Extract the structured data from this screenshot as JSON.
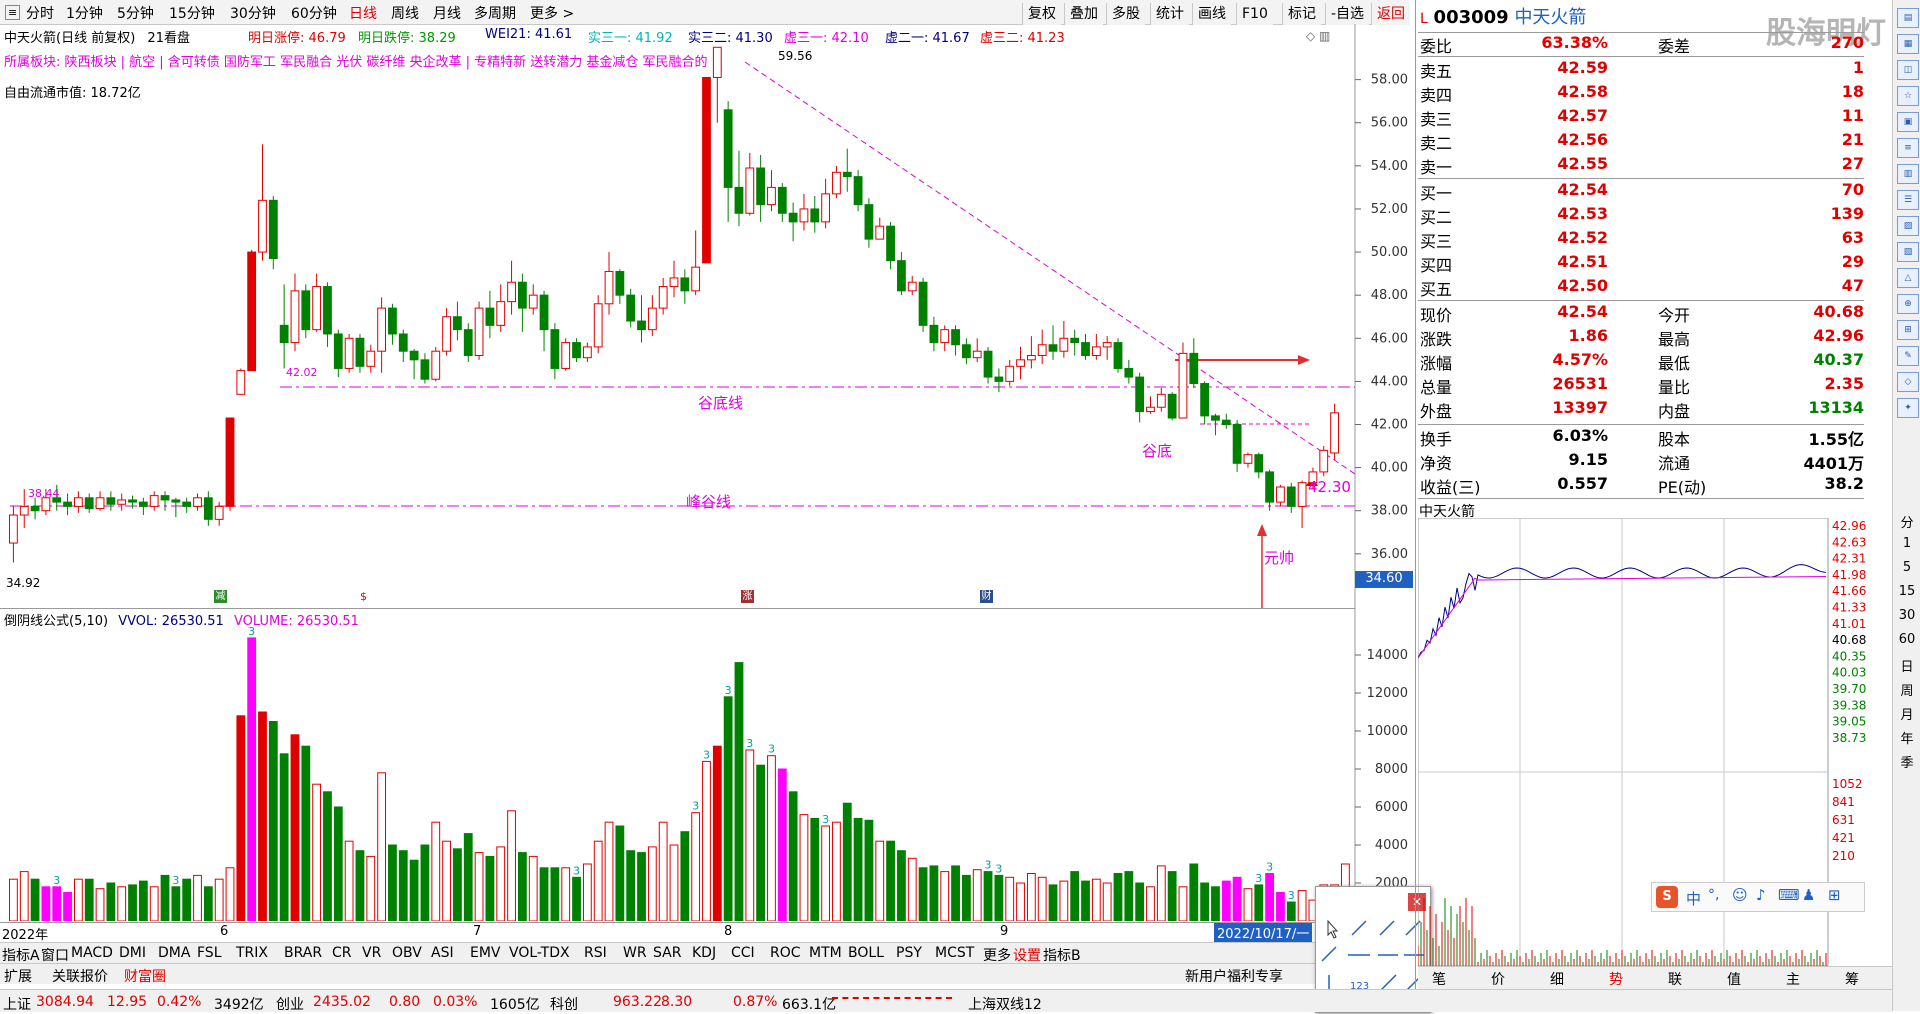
{
  "toolbar": {
    "periods": [
      "分时",
      "1分钟",
      "5分钟",
      "15分钟",
      "30分钟",
      "60分钟",
      "日线",
      "周线",
      "月线",
      "多周期",
      "更多 >"
    ],
    "right_buttons": [
      "复权",
      "叠加",
      "多股",
      "统计",
      "画线",
      "F10",
      "标记",
      "-自选",
      "返回"
    ]
  },
  "stock_header": {
    "prefix": "L",
    "code": "003009",
    "name": "中天火箭",
    "watermark": "股海明灯"
  },
  "chart_header": {
    "title": "中天火箭(日线 前复权)",
    "views": "21看盘",
    "limit_up_label": "明日涨停:",
    "limit_up": "46.79",
    "limit_down_label": "明日跌停:",
    "limit_down": "38.29",
    "wei21": "WEI21: 41.61",
    "shi1": "实三一: 41.92",
    "shi2": "实三二: 41.30",
    "xu31": "虚三一: 42.10",
    "xu21": "虚二一: 41.67",
    "xu32": "虚三二: 41.23",
    "sectors": "所属板块: 陕西板块 | 航空 | 含可转债 国防军工 军民融合 光伏 碳纤维 央企改革 | 专精特新 送转潜力 基金减仓 军民融合的",
    "float_cap": "自由流通市值: 18.72亿"
  },
  "annotations": {
    "valley_line": "谷底线",
    "peak_valley_line": "峰谷线",
    "valley": "谷底",
    "yuanshuai": "元帅",
    "price_4230": "42.30",
    "high_label": "59.56",
    "low_label": "34.92",
    "left_label": "38.44",
    "mid_label": "42.02",
    "cursor_price": "34.60"
  },
  "chart_data": {
    "type": "candlestick",
    "price_axis": [
      "58.00",
      "56.00",
      "54.00",
      "52.00",
      "50.00",
      "48.00",
      "46.00",
      "44.00",
      "42.00",
      "40.00",
      "38.00",
      "36.00"
    ],
    "ylim": [
      34.6,
      59.56
    ],
    "candles": [
      [
        36.5,
        37.8,
        35.6,
        38.2
      ],
      [
        37.8,
        38.2,
        37.2,
        39.0
      ],
      [
        38.2,
        38.0,
        37.6,
        38.6
      ],
      [
        38.0,
        38.6,
        37.8,
        39.0
      ],
      [
        38.6,
        38.4,
        38.0,
        39.2
      ],
      [
        38.4,
        38.2,
        37.8,
        38.8
      ],
      [
        38.2,
        38.6,
        37.9,
        38.9
      ],
      [
        38.6,
        38.1,
        37.9,
        38.8
      ],
      [
        38.1,
        38.6,
        38.0,
        38.9
      ],
      [
        38.6,
        38.3,
        38.0,
        38.9
      ],
      [
        38.3,
        38.5,
        38.0,
        38.8
      ],
      [
        38.5,
        38.4,
        38.1,
        38.7
      ],
      [
        38.4,
        38.2,
        37.8,
        38.6
      ],
      [
        38.2,
        38.7,
        38.0,
        38.9
      ],
      [
        38.7,
        38.5,
        38.0,
        38.9
      ],
      [
        38.5,
        38.4,
        37.7,
        38.6
      ],
      [
        38.4,
        38.2,
        37.9,
        38.6
      ],
      [
        38.2,
        38.6,
        38.0,
        38.8
      ],
      [
        38.6,
        37.6,
        37.3,
        38.9
      ],
      [
        37.6,
        38.2,
        37.3,
        38.4
      ],
      [
        38.2,
        42.3,
        38.0,
        42.3
      ],
      [
        43.4,
        44.5,
        43.8,
        44.6
      ],
      [
        44.5,
        50.0,
        45.0,
        50.1
      ],
      [
        50.0,
        52.4,
        49.6,
        55.0
      ],
      [
        52.4,
        49.7,
        49.2,
        52.6
      ],
      [
        46.6,
        45.8,
        44.6,
        48.5
      ],
      [
        45.8,
        48.2,
        45.4,
        49.0
      ],
      [
        48.2,
        46.4,
        46.0,
        48.5
      ],
      [
        46.4,
        48.4,
        46.3,
        49.0
      ],
      [
        48.4,
        46.2,
        45.6,
        48.6
      ],
      [
        46.2,
        44.6,
        44.2,
        46.4
      ],
      [
        44.6,
        46.0,
        44.4,
        46.2
      ],
      [
        46.0,
        44.7,
        44.4,
        46.2
      ],
      [
        44.7,
        45.4,
        44.4,
        45.7
      ],
      [
        45.4,
        47.4,
        44.4,
        47.9
      ],
      [
        47.4,
        46.2,
        45.7,
        47.6
      ],
      [
        46.2,
        45.4,
        44.9,
        46.4
      ],
      [
        45.4,
        45.0,
        44.1,
        45.5
      ],
      [
        45.0,
        44.1,
        43.9,
        45.3
      ],
      [
        44.1,
        45.4,
        44.0,
        45.6
      ],
      [
        45.4,
        47.0,
        45.2,
        47.4
      ],
      [
        47.0,
        46.4,
        45.9,
        47.7
      ],
      [
        46.4,
        45.2,
        44.9,
        46.7
      ],
      [
        45.2,
        47.4,
        45.0,
        47.7
      ],
      [
        47.4,
        46.6,
        46.0,
        48.2
      ],
      [
        46.6,
        47.7,
        46.3,
        48.5
      ],
      [
        47.7,
        48.6,
        47.1,
        49.6
      ],
      [
        48.6,
        47.4,
        46.3,
        49.0
      ],
      [
        47.4,
        48.0,
        47.1,
        48.5
      ],
      [
        48.0,
        46.4,
        45.4,
        48.2
      ],
      [
        46.4,
        44.6,
        44.1,
        46.7
      ],
      [
        44.6,
        45.8,
        44.5,
        46.0
      ],
      [
        45.8,
        45.1,
        44.9,
        46.0
      ],
      [
        45.1,
        45.6,
        44.9,
        45.8
      ],
      [
        45.6,
        47.6,
        45.3,
        48.0
      ],
      [
        47.6,
        49.1,
        47.1,
        50.0
      ],
      [
        49.1,
        48.0,
        47.6,
        49.2
      ],
      [
        48.0,
        46.8,
        46.5,
        48.3
      ],
      [
        46.8,
        46.4,
        45.8,
        48.0
      ],
      [
        46.4,
        47.4,
        46.1,
        48.0
      ],
      [
        47.4,
        48.4,
        47.1,
        48.8
      ],
      [
        48.4,
        48.8,
        47.9,
        49.6
      ],
      [
        48.8,
        48.2,
        47.6,
        49.2
      ],
      [
        48.2,
        49.3,
        48.0,
        51.0
      ],
      [
        49.5,
        58.1,
        49.6,
        58.1
      ],
      [
        58.1,
        59.5,
        56.0,
        59.5
      ],
      [
        56.6,
        53.0,
        51.4,
        57.0
      ],
      [
        53.0,
        51.8,
        51.2,
        54.7
      ],
      [
        51.8,
        53.9,
        51.7,
        54.6
      ],
      [
        53.9,
        52.2,
        51.4,
        54.5
      ],
      [
        52.2,
        53.0,
        51.9,
        53.8
      ],
      [
        53.0,
        51.8,
        51.4,
        53.2
      ],
      [
        51.8,
        51.4,
        50.5,
        52.3
      ],
      [
        51.4,
        52.0,
        51.0,
        52.7
      ],
      [
        52.0,
        51.4,
        50.9,
        52.6
      ],
      [
        51.4,
        52.7,
        51.1,
        53.4
      ],
      [
        52.7,
        53.7,
        52.5,
        54.0
      ],
      [
        53.7,
        53.5,
        52.8,
        54.8
      ],
      [
        53.5,
        52.2,
        51.9,
        53.8
      ],
      [
        52.2,
        50.6,
        50.2,
        52.5
      ],
      [
        50.6,
        51.2,
        50.6,
        51.6
      ],
      [
        51.2,
        49.6,
        49.2,
        51.4
      ],
      [
        49.6,
        48.2,
        48.0,
        50.0
      ],
      [
        48.2,
        48.6,
        48.0,
        48.9
      ],
      [
        48.6,
        46.6,
        46.3,
        48.8
      ],
      [
        46.6,
        45.8,
        45.4,
        47.0
      ],
      [
        45.8,
        46.4,
        45.4,
        46.6
      ],
      [
        46.4,
        45.7,
        45.2,
        46.6
      ],
      [
        45.7,
        45.1,
        44.8,
        46.0
      ],
      [
        45.1,
        45.4,
        44.9,
        46.0
      ],
      [
        45.4,
        44.2,
        43.9,
        45.6
      ],
      [
        44.2,
        44.0,
        43.5,
        44.6
      ],
      [
        44.0,
        44.7,
        43.8,
        45.0
      ],
      [
        44.7,
        45.0,
        44.1,
        45.6
      ],
      [
        45.0,
        45.2,
        44.6,
        46.1
      ],
      [
        45.2,
        45.7,
        44.8,
        46.4
      ],
      [
        45.7,
        45.4,
        45.0,
        46.6
      ],
      [
        45.4,
        46.0,
        45.1,
        46.8
      ],
      [
        46.0,
        45.8,
        45.2,
        46.4
      ],
      [
        45.8,
        45.2,
        45.0,
        46.2
      ],
      [
        45.2,
        45.6,
        45.0,
        46.2
      ],
      [
        45.6,
        45.8,
        45.0,
        46.1
      ],
      [
        45.8,
        44.6,
        44.4,
        46.0
      ],
      [
        44.6,
        44.2,
        43.9,
        45.0
      ],
      [
        44.2,
        42.6,
        42.1,
        44.4
      ],
      [
        42.6,
        42.8,
        42.5,
        43.3
      ],
      [
        42.8,
        43.4,
        42.6,
        43.7
      ],
      [
        43.4,
        42.3,
        42.2,
        43.5
      ],
      [
        42.3,
        45.3,
        42.6,
        45.8
      ],
      [
        45.3,
        43.9,
        43.7,
        46.0
      ],
      [
        43.9,
        42.4,
        42.0,
        44.0
      ],
      [
        42.4,
        42.2,
        41.5,
        42.5
      ],
      [
        42.2,
        42.0,
        41.8,
        42.5
      ],
      [
        42.0,
        40.2,
        39.8,
        42.2
      ],
      [
        40.2,
        40.6,
        40.0,
        40.7
      ],
      [
        40.6,
        39.8,
        39.5,
        40.7
      ],
      [
        39.8,
        38.4,
        38.0,
        39.9
      ],
      [
        38.4,
        39.1,
        38.2,
        39.2
      ],
      [
        39.1,
        38.2,
        37.9,
        39.3
      ],
      [
        38.2,
        39.3,
        37.2,
        39.4
      ],
      [
        39.3,
        39.8,
        39.0,
        40.0
      ],
      [
        39.8,
        40.8,
        39.6,
        41.0
      ],
      [
        40.68,
        42.54,
        40.37,
        42.96
      ]
    ],
    "volumes": [
      2200,
      2600,
      2200,
      1800,
      1800,
      1500,
      2200,
      2200,
      1700,
      2000,
      1800,
      1900,
      2100,
      1800,
      2400,
      1800,
      2200,
      2400,
      1800,
      2200,
      2800,
      10800,
      14900,
      11000,
      10500,
      8800,
      9800,
      9200,
      7200,
      6800,
      6000,
      4200,
      3700,
      3400,
      7800,
      4000,
      3700,
      3200,
      4000,
      5200,
      4200,
      3800,
      4600,
      3600,
      3400,
      3900,
      5800,
      3600,
      3400,
      2800,
      2800,
      2800,
      2300,
      3000,
      4200,
      5200,
      5000,
      3700,
      3600,
      3900,
      5200,
      4000,
      4700,
      5700,
      8400,
      9200,
      11800,
      13600,
      9000,
      8200,
      8700,
      8000,
      6800,
      5600,
      5400,
      5000,
      5200,
      6200,
      5400,
      5300,
      4200,
      4200,
      3700,
      3300,
      2800,
      2900,
      2600,
      2900,
      2400,
      2700,
      2600,
      2400,
      2300,
      2000,
      2500,
      2300,
      1900,
      2100,
      2600,
      2100,
      2200,
      2000,
      2500,
      2600,
      2000,
      1800,
      2900,
      2600,
      1800,
      3000,
      2000,
      1800,
      2100,
      2300,
      1700,
      1900,
      2500,
      1500,
      1000,
      1600,
      1100,
      1900,
      1900,
      3000
    ],
    "vol_axis": [
      "14000",
      "12000",
      "10000",
      "8000",
      "6000",
      "4000",
      "2000"
    ],
    "date_labels": [
      "2022年",
      "6",
      "7",
      "8",
      "9",
      "2022/10/17/一"
    ]
  },
  "volume_header": {
    "title": "倒阴线公式(5,10)",
    "vvol": "VVOL: 26530.51",
    "volume": "VOLUME: 26530.51"
  },
  "indicator_tabs": [
    "指标A",
    "窗口",
    "MACD",
    "DMI",
    "DMA",
    "FSL",
    "TRIX",
    "BRAR",
    "CR",
    "VR",
    "OBV",
    "ASI",
    "EMV",
    "VOL-TDX",
    "RSI",
    "WR",
    "SAR",
    "KDJ",
    "CCI",
    "ROC",
    "MTM",
    "BOLL",
    "PSY",
    "MCST",
    "更多",
    "设置",
    "指标B"
  ],
  "sub_tabs": [
    "扩展",
    "关联报价",
    "财富圈"
  ],
  "promo": "新用户福利专享",
  "order_book": {
    "weibi_label": "委比",
    "weibi": "63.38%",
    "weicha_label": "委差",
    "weicha": "270",
    "sells": [
      {
        "label": "卖五",
        "price": "42.59",
        "vol": "1"
      },
      {
        "label": "卖四",
        "price": "42.58",
        "vol": "18"
      },
      {
        "label": "卖三",
        "price": "42.57",
        "vol": "11"
      },
      {
        "label": "卖二",
        "price": "42.56",
        "vol": "21"
      },
      {
        "label": "卖一",
        "price": "42.55",
        "vol": "27"
      }
    ],
    "buys": [
      {
        "label": "买一",
        "price": "42.54",
        "vol": "70"
      },
      {
        "label": "买二",
        "price": "42.53",
        "vol": "139"
      },
      {
        "label": "买三",
        "price": "42.52",
        "vol": "63"
      },
      {
        "label": "买四",
        "price": "42.51",
        "vol": "29"
      },
      {
        "label": "买五",
        "price": "42.50",
        "vol": "47"
      }
    ]
  },
  "quote": [
    {
      "l1": "现价",
      "v1": "42.54",
      "l2": "今开",
      "v2": "40.68"
    },
    {
      "l1": "涨跌",
      "v1": "1.86",
      "l2": "最高",
      "v2": "42.96"
    },
    {
      "l1": "涨幅",
      "v1": "4.57%",
      "l2": "最低",
      "v2": "40.37"
    },
    {
      "l1": "总量",
      "v1": "26531",
      "l2": "量比",
      "v2": "2.35"
    },
    {
      "l1": "外盘",
      "v1": "13397",
      "l2": "内盘",
      "v2": "13134"
    }
  ],
  "fundamentals": [
    {
      "l1": "换手",
      "v1": "6.03%",
      "l2": "股本",
      "v2": "1.55亿"
    },
    {
      "l1": "净资",
      "v1": "9.15",
      "l2": "流通",
      "v2": "4401万"
    },
    {
      "l1": "收益(三)",
      "v1": "0.557",
      "l2": "PE(动)",
      "v2": "38.2"
    }
  ],
  "intraday": {
    "title": "中天火箭",
    "price_ticks": [
      "42.96",
      "42.63",
      "42.31",
      "41.98",
      "41.66",
      "41.33",
      "41.01",
      "40.68",
      "40.35",
      "40.03",
      "39.70",
      "39.38",
      "39.05",
      "38.73"
    ],
    "vol_ticks": [
      "1052",
      "841",
      "631",
      "421",
      "210"
    ],
    "tabs": [
      "笔",
      "价",
      "细",
      "势",
      "联",
      "值",
      "主",
      "筹"
    ]
  },
  "sidebar_icons": [
    "分",
    "1",
    "5",
    "15",
    "30",
    "60",
    "日",
    "周",
    "月",
    "年",
    "季"
  ],
  "status_bar": {
    "sh_label": "上证",
    "sh": "3084.94",
    "sh_chg": "12.95",
    "sh_pct": "0.42%",
    "sh_amt": "3492亿",
    "cy_label": "创业",
    "cy": "2435.02",
    "cy_chg": "0.80",
    "cy_pct": "0.03%",
    "cy_amt": "1605亿",
    "kc_label": "科创",
    "kc": "963.22",
    "kc_chg": "8.30",
    "kc_pct": "0.87%",
    "kc_amt": "663.1亿",
    "shanghai": "上海双线12"
  },
  "ime": {
    "brand": "S",
    "lang": "中"
  }
}
